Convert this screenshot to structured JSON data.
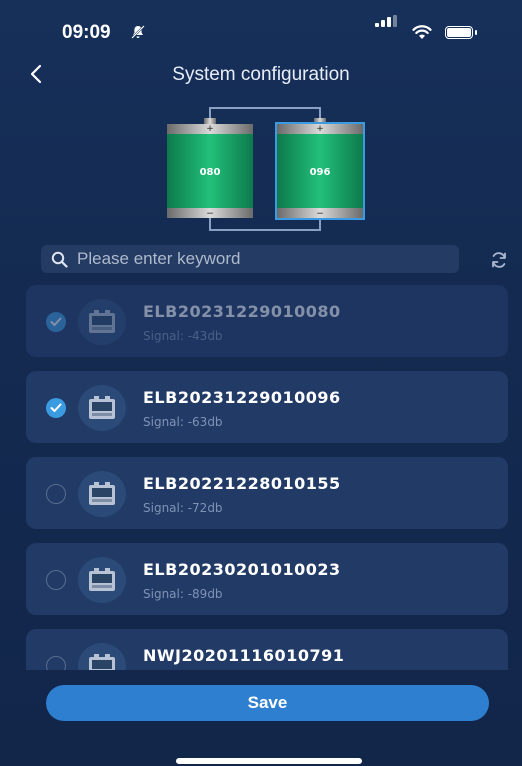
{
  "status_bar": {
    "time": "09:09",
    "icons": [
      "bell-off-icon",
      "signal-icon",
      "wifi-icon",
      "battery-icon"
    ]
  },
  "header": {
    "title": "System configuration",
    "back_icon": "chevron-left-icon"
  },
  "batteries": [
    {
      "label": "080",
      "color": "#1aa866",
      "selected": false
    },
    {
      "label": "096",
      "color": "#1aa866",
      "selected": true
    }
  ],
  "search": {
    "placeholder": "Please enter keyword",
    "value": "",
    "refresh_icon": "refresh-icon"
  },
  "devices": [
    {
      "serial": "ELB20231229010080",
      "signal": "Signal: -43db",
      "checked": true,
      "disabled": true
    },
    {
      "serial": "ELB20231229010096",
      "signal": "Signal: -63db",
      "checked": true,
      "disabled": false
    },
    {
      "serial": "ELB20221228010155",
      "signal": "Signal: -72db",
      "checked": false,
      "disabled": false
    },
    {
      "serial": "ELB20230201010023",
      "signal": "Signal: -89db",
      "checked": false,
      "disabled": false
    },
    {
      "serial": "NWJ20201116010791",
      "signal": "",
      "checked": false,
      "disabled": false
    }
  ],
  "actions": {
    "save_label": "Save"
  },
  "colors": {
    "background": "#16305a",
    "card": "#213a66",
    "accent": "#3a9be0",
    "save": "#2f7fd1",
    "battery_green": "#1aa866"
  }
}
